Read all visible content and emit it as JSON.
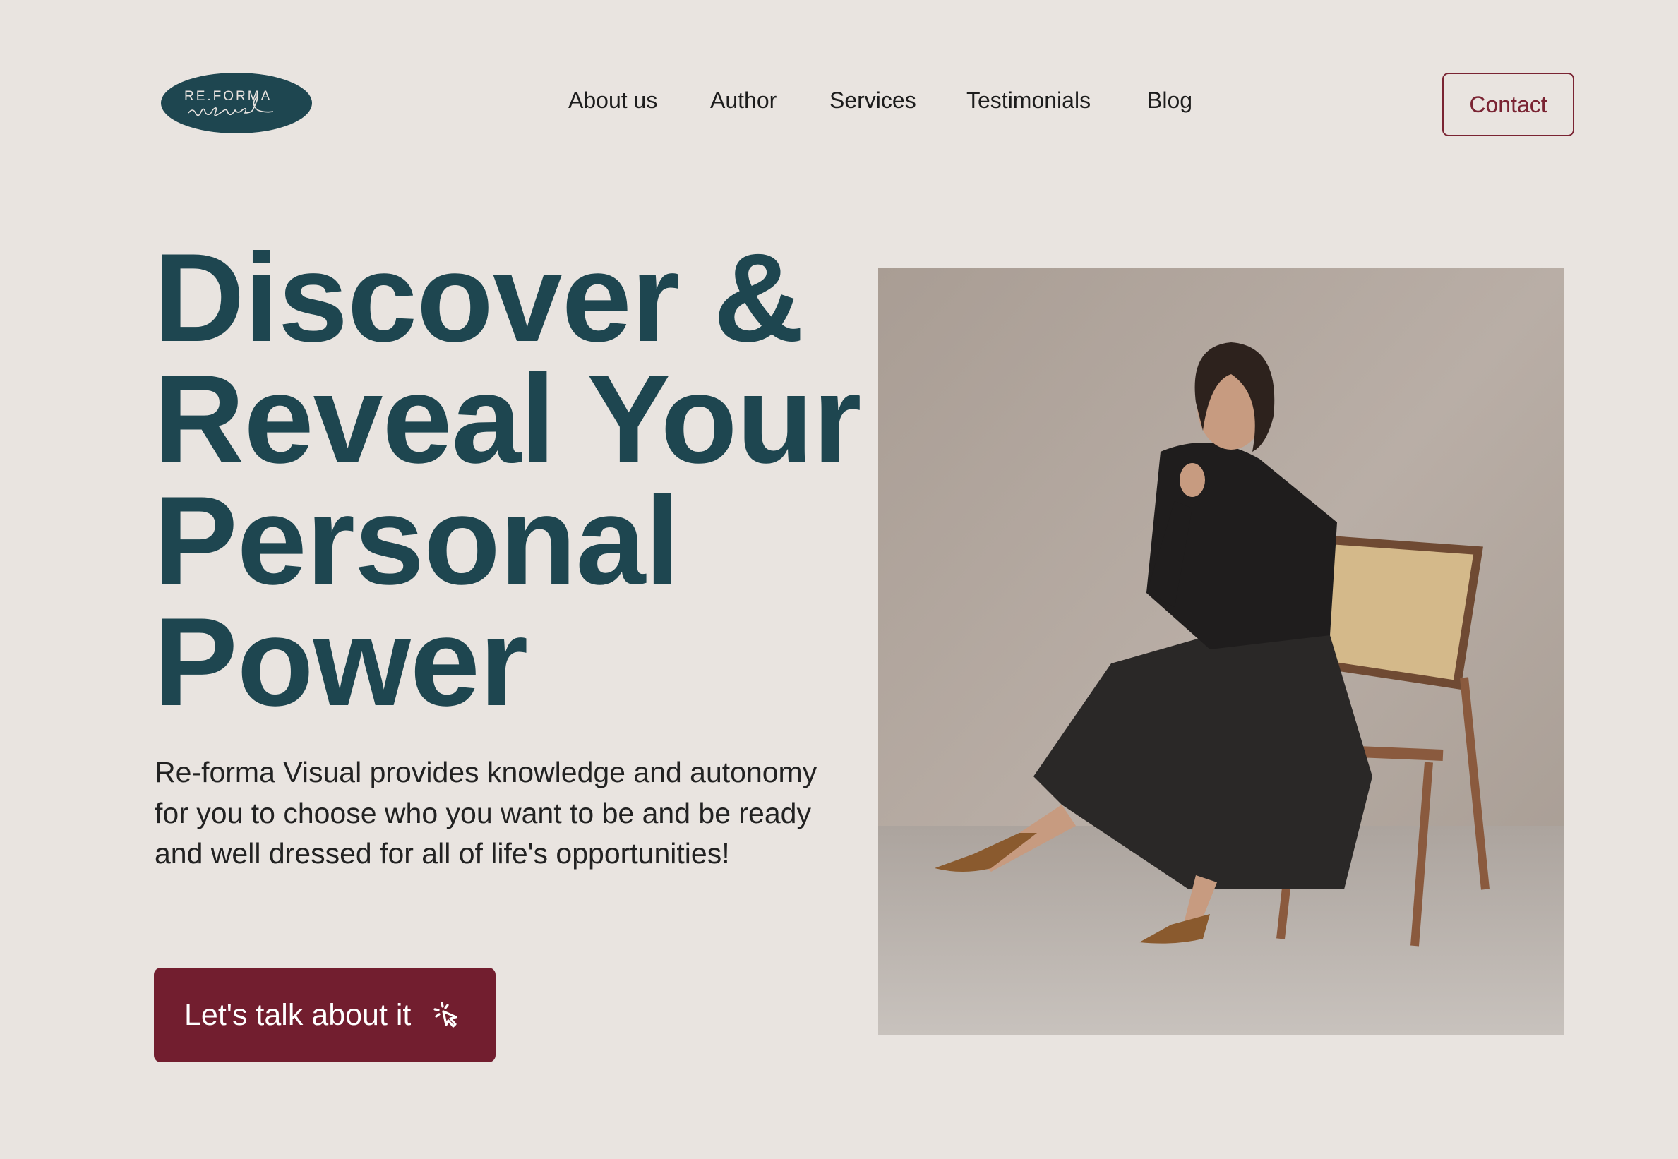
{
  "brand": {
    "logo_text_top": "RE.FORMA",
    "logo_text_script": "visual",
    "color": "#1e4650"
  },
  "nav": {
    "items": [
      {
        "label": "About us"
      },
      {
        "label": "Author"
      },
      {
        "label": "Services"
      },
      {
        "label": "Testimonials"
      },
      {
        "label": "Blog"
      }
    ],
    "contact_label": "Contact"
  },
  "hero": {
    "headline_lines": [
      "Discover &",
      "Reveal Your",
      "Personal",
      "Power"
    ],
    "lead": "Re-forma Visual provides knowledge and autonomy for you to choose who you want to be and be ready and well dressed for all of life's opportunities!",
    "cta_label": "Let's talk about it",
    "cta_icon": "cursor-click-icon",
    "image_subject": "woman-in-black-dress-seated-on-cane-chair"
  },
  "colors": {
    "background": "#e9e4e0",
    "accent": "#721e2f",
    "heading": "#1e4650"
  }
}
